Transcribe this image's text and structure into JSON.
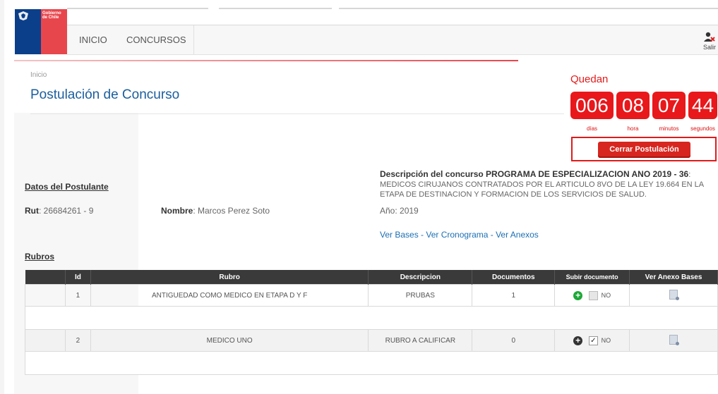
{
  "branding": {
    "logo_line1": "Gobierno",
    "logo_line2": "de Chile"
  },
  "nav": {
    "items": [
      "INICIO",
      "CONCURSOS"
    ],
    "user_label": "Salir"
  },
  "breadcrumb": "Inicio",
  "page_title": "Postulación de Concurso",
  "countdown": {
    "heading": "Quedan",
    "units": [
      {
        "value": "006",
        "label": "días"
      },
      {
        "value": "08",
        "label": "hora"
      },
      {
        "value": "07",
        "label": "minutos"
      },
      {
        "value": "44",
        "label": "segundos"
      }
    ],
    "close_button": "Cerrar Postulación"
  },
  "applicant": {
    "section_title": "Datos del Postulante",
    "rut_label": "Rut",
    "rut_value": ": 26684261 - 9",
    "name_label": "Nombre",
    "name_value": ": Marcos Perez Soto"
  },
  "contest": {
    "desc_prefix": "Descripción del concurso ",
    "desc_name": "PROGRAMA DE ESPECIALIZACION ANO 2019 - 36",
    "desc_text": ": MEDICOS CIRUJANOS CONTRATADOS POR EL ARTICULO 8VO DE LA LEY 19.664 EN LA ETAPA DE DESTINACION Y FORMACION DE LOS SERVICIOS DE SALUD.",
    "year": "Año: 2019",
    "link_bases": "Ver Bases",
    "link_cronograma": "Ver Cronograma",
    "link_anexos": "Ver Anexos",
    "link_sep": " - "
  },
  "rubros": {
    "section_title": "Rubros",
    "columns": [
      "",
      "Id",
      "Rubro",
      "Descripcion",
      "Documentos",
      "Subir documento",
      "Ver Anexo Bases"
    ],
    "rows": [
      {
        "id": "1",
        "rubro": "ANTIGUEDAD COMO MEDICO EN ETAPA D Y F",
        "descripcion": "PRUBAS",
        "documentos": "1",
        "upload_icon": "plus-circle-green",
        "checked": false,
        "check_label": "NO",
        "annex_icon": "document-icon"
      },
      {
        "id": "2",
        "rubro": "MEDICO UNO",
        "descripcion": "RUBRO A CALIFICAR",
        "documentos": "0",
        "upload_icon": "plus-circle-dark",
        "checked": true,
        "check_label": "NO",
        "annex_icon": "document-icon"
      }
    ]
  },
  "colors": {
    "accent_blue": "#1a5e9c",
    "countdown_red": "#e8181b",
    "upload_green": "#1ea838",
    "upload_dark": "#333333"
  }
}
